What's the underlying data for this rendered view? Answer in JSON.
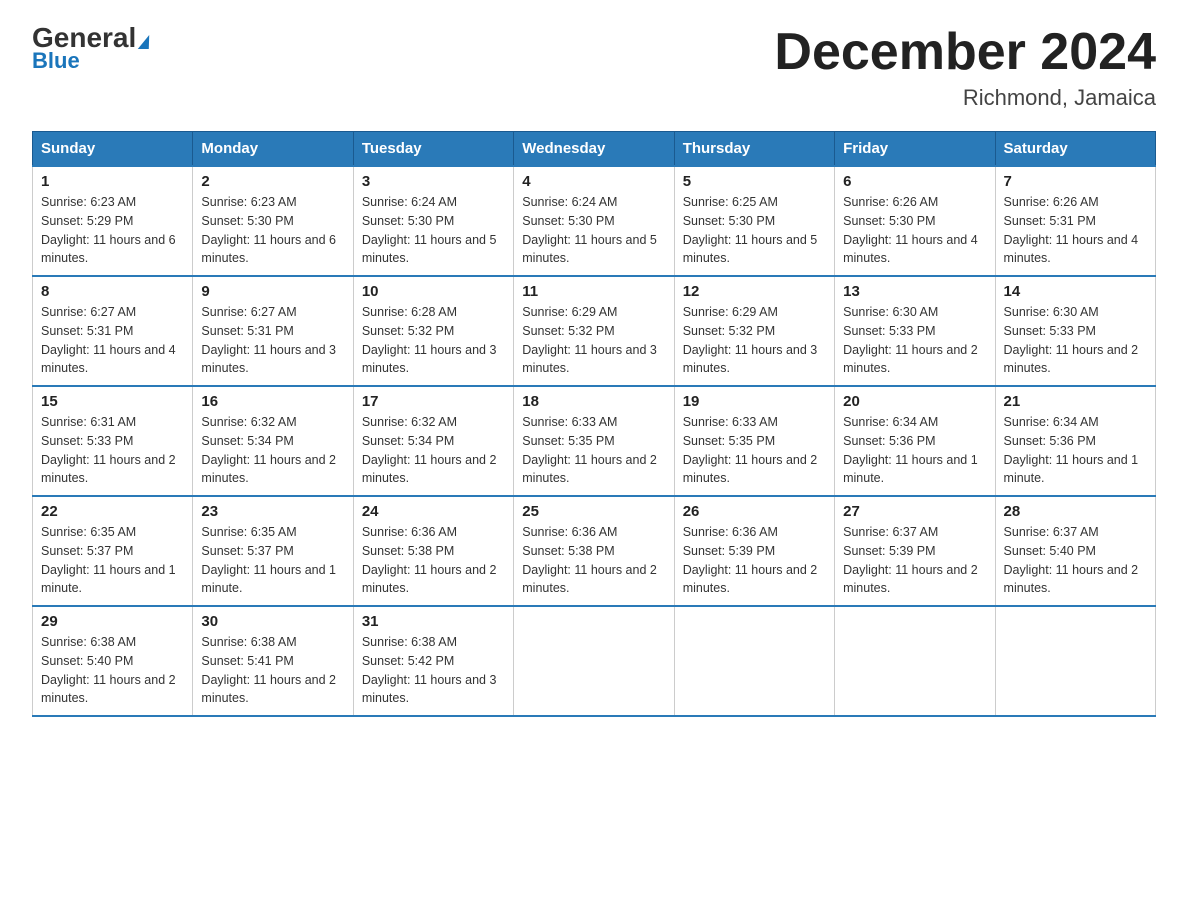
{
  "header": {
    "logo_line1": "General",
    "logo_line2": "Blue",
    "title": "December 2024",
    "subtitle": "Richmond, Jamaica"
  },
  "columns": [
    "Sunday",
    "Monday",
    "Tuesday",
    "Wednesday",
    "Thursday",
    "Friday",
    "Saturday"
  ],
  "weeks": [
    [
      {
        "day": "1",
        "sunrise": "6:23 AM",
        "sunset": "5:29 PM",
        "daylight": "11 hours and 6 minutes."
      },
      {
        "day": "2",
        "sunrise": "6:23 AM",
        "sunset": "5:30 PM",
        "daylight": "11 hours and 6 minutes."
      },
      {
        "day": "3",
        "sunrise": "6:24 AM",
        "sunset": "5:30 PM",
        "daylight": "11 hours and 5 minutes."
      },
      {
        "day": "4",
        "sunrise": "6:24 AM",
        "sunset": "5:30 PM",
        "daylight": "11 hours and 5 minutes."
      },
      {
        "day": "5",
        "sunrise": "6:25 AM",
        "sunset": "5:30 PM",
        "daylight": "11 hours and 5 minutes."
      },
      {
        "day": "6",
        "sunrise": "6:26 AM",
        "sunset": "5:30 PM",
        "daylight": "11 hours and 4 minutes."
      },
      {
        "day": "7",
        "sunrise": "6:26 AM",
        "sunset": "5:31 PM",
        "daylight": "11 hours and 4 minutes."
      }
    ],
    [
      {
        "day": "8",
        "sunrise": "6:27 AM",
        "sunset": "5:31 PM",
        "daylight": "11 hours and 4 minutes."
      },
      {
        "day": "9",
        "sunrise": "6:27 AM",
        "sunset": "5:31 PM",
        "daylight": "11 hours and 3 minutes."
      },
      {
        "day": "10",
        "sunrise": "6:28 AM",
        "sunset": "5:32 PM",
        "daylight": "11 hours and 3 minutes."
      },
      {
        "day": "11",
        "sunrise": "6:29 AM",
        "sunset": "5:32 PM",
        "daylight": "11 hours and 3 minutes."
      },
      {
        "day": "12",
        "sunrise": "6:29 AM",
        "sunset": "5:32 PM",
        "daylight": "11 hours and 3 minutes."
      },
      {
        "day": "13",
        "sunrise": "6:30 AM",
        "sunset": "5:33 PM",
        "daylight": "11 hours and 2 minutes."
      },
      {
        "day": "14",
        "sunrise": "6:30 AM",
        "sunset": "5:33 PM",
        "daylight": "11 hours and 2 minutes."
      }
    ],
    [
      {
        "day": "15",
        "sunrise": "6:31 AM",
        "sunset": "5:33 PM",
        "daylight": "11 hours and 2 minutes."
      },
      {
        "day": "16",
        "sunrise": "6:32 AM",
        "sunset": "5:34 PM",
        "daylight": "11 hours and 2 minutes."
      },
      {
        "day": "17",
        "sunrise": "6:32 AM",
        "sunset": "5:34 PM",
        "daylight": "11 hours and 2 minutes."
      },
      {
        "day": "18",
        "sunrise": "6:33 AM",
        "sunset": "5:35 PM",
        "daylight": "11 hours and 2 minutes."
      },
      {
        "day": "19",
        "sunrise": "6:33 AM",
        "sunset": "5:35 PM",
        "daylight": "11 hours and 2 minutes."
      },
      {
        "day": "20",
        "sunrise": "6:34 AM",
        "sunset": "5:36 PM",
        "daylight": "11 hours and 1 minute."
      },
      {
        "day": "21",
        "sunrise": "6:34 AM",
        "sunset": "5:36 PM",
        "daylight": "11 hours and 1 minute."
      }
    ],
    [
      {
        "day": "22",
        "sunrise": "6:35 AM",
        "sunset": "5:37 PM",
        "daylight": "11 hours and 1 minute."
      },
      {
        "day": "23",
        "sunrise": "6:35 AM",
        "sunset": "5:37 PM",
        "daylight": "11 hours and 1 minute."
      },
      {
        "day": "24",
        "sunrise": "6:36 AM",
        "sunset": "5:38 PM",
        "daylight": "11 hours and 2 minutes."
      },
      {
        "day": "25",
        "sunrise": "6:36 AM",
        "sunset": "5:38 PM",
        "daylight": "11 hours and 2 minutes."
      },
      {
        "day": "26",
        "sunrise": "6:36 AM",
        "sunset": "5:39 PM",
        "daylight": "11 hours and 2 minutes."
      },
      {
        "day": "27",
        "sunrise": "6:37 AM",
        "sunset": "5:39 PM",
        "daylight": "11 hours and 2 minutes."
      },
      {
        "day": "28",
        "sunrise": "6:37 AM",
        "sunset": "5:40 PM",
        "daylight": "11 hours and 2 minutes."
      }
    ],
    [
      {
        "day": "29",
        "sunrise": "6:38 AM",
        "sunset": "5:40 PM",
        "daylight": "11 hours and 2 minutes."
      },
      {
        "day": "30",
        "sunrise": "6:38 AM",
        "sunset": "5:41 PM",
        "daylight": "11 hours and 2 minutes."
      },
      {
        "day": "31",
        "sunrise": "6:38 AM",
        "sunset": "5:42 PM",
        "daylight": "11 hours and 3 minutes."
      },
      null,
      null,
      null,
      null
    ]
  ]
}
